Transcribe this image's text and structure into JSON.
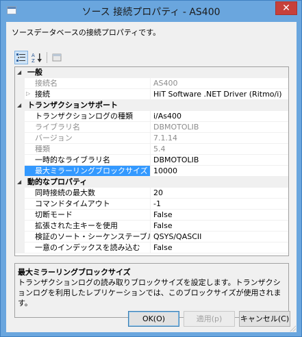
{
  "window": {
    "title": "ソース 接続プロパティ - AS400",
    "close_label": "✕"
  },
  "description": "ソースデータベースの接続プロパティです。",
  "toolbar": {
    "categorized_icon": "categorized-view-icon",
    "alpha_icon": "alphabetical-sort-icon",
    "pages_icon": "property-pages-icon"
  },
  "grid": {
    "categories": [
      {
        "label": "一般",
        "rows": [
          {
            "name": "接続名",
            "value": "AS400",
            "dim": true
          },
          {
            "name": "接続",
            "value": "HiT Software .NET Driver (Ritmo/i)",
            "dim": false,
            "expandable": true
          }
        ]
      },
      {
        "label": "トランザクションサポート",
        "rows": [
          {
            "name": "トランザクションログの種類",
            "value": "i/As400",
            "dim": false
          },
          {
            "name": "ライブラリ名",
            "value": "DBMOTOLIB",
            "dim": true
          },
          {
            "name": "バージョン",
            "value": "7.1.14",
            "dim": true
          },
          {
            "name": "種類",
            "value": "5.4",
            "dim": true
          },
          {
            "name": "一時的なライブラリ名",
            "value": "DBMOTOLIB",
            "dim": false
          },
          {
            "name": "最大ミラーリングブロックサイズ",
            "value": "10000",
            "dim": false,
            "selected": true
          }
        ]
      },
      {
        "label": "動的なプロパティ",
        "rows": [
          {
            "name": "同時接続の最大数",
            "value": "20",
            "dim": false
          },
          {
            "name": "コマンドタイムアウト",
            "value": "-1",
            "dim": false
          },
          {
            "name": "切断モード",
            "value": "False",
            "dim": false
          },
          {
            "name": "拡張された主キーを使用",
            "value": "False",
            "dim": false
          },
          {
            "name": "検証のソート・シーケンステーブル",
            "value": "QSYS/QASCII",
            "dim": false
          },
          {
            "name": "一意のインデックスを読み込む",
            "value": "False",
            "dim": false
          }
        ]
      }
    ]
  },
  "help": {
    "title": "最大ミラーリングブロックサイズ",
    "text": "トランザクションログの読み取りブロックサイズを設定します。トランザクションログを利用したレプリケーションでは、このブロックサイズが使用されます。"
  },
  "buttons": {
    "ok": "OK(O)",
    "apply": "適用(p)",
    "cancel": "キャンセル(C)"
  }
}
